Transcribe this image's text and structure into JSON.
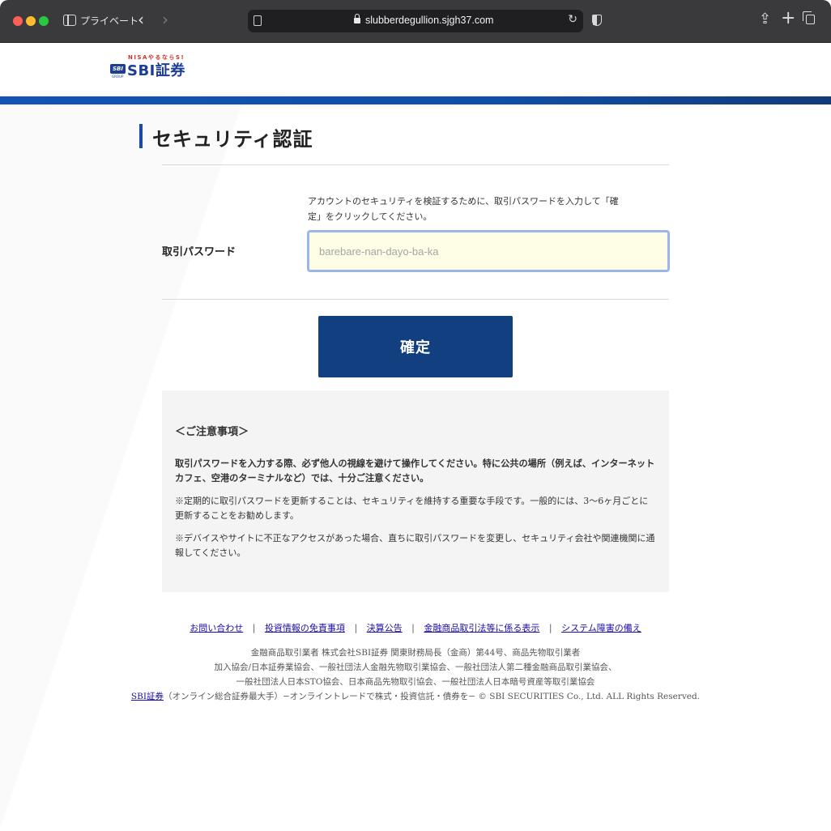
{
  "browser": {
    "private_label": "プライベート",
    "url": "slubberdegullion.sjgh37.com"
  },
  "logo": {
    "nisa_text": "NISAやるならS!",
    "badge_text": "SBI",
    "group_text": "GROUP",
    "main_text": "SBI証券"
  },
  "page": {
    "title": "セキュリティ認証",
    "instructions": "アカウントのセキュリティを検証するために、取引パスワードを入力して「確定」をクリックしてください。",
    "password_label": "取引パスワード",
    "password_value": "barebare-nan-dayo-ba-ka",
    "confirm_label": "確定"
  },
  "notice": {
    "heading": "＜ご注意事項＞",
    "paragraphs": [
      "取引パスワードを入力する際、必ず他人の視線を避けて操作してください。特に公共の場所（例えば、インターネットカフェ、空港のターミナルなど）では、十分ご注意ください。",
      "※定期的に取引パスワードを更新することは、セキュリティを維持する重要な手段です。一般的には、3〜6ヶ月ごとに更新することをお勧めします。",
      "※デバイスやサイトに不正なアクセスがあった場合、直ちに取引パスワードを変更し、セキュリティ会社や関連機関に通報してください。"
    ]
  },
  "footer": {
    "links": [
      "お問い合わせ",
      "投資情報の免責事項",
      "決算公告",
      "金融商品取引法等に係る表示",
      "システム障害の備え"
    ],
    "separator": "|",
    "lines": [
      "金融商品取引業者 株式会社SBI証券 関東財務局長（金商）第44号、商品先物取引業者",
      "加入協会/日本証券業協会、一般社団法人金融先物取引業協会、一般社団法人第二種金融商品取引業協会、",
      "一般社団法人日本STO協会、日本商品先物取引協会、一般社団法人日本暗号資産等取引業協会"
    ],
    "copyright_link": "SBI証券",
    "copyright_text": "（オンライン総合証券最大手）−オンライントレードで株式・投資信託・債券を− © SBI SECURITIES Co., Ltd. ALL Rights Reserved."
  },
  "colors": {
    "header_bar": "#0f4fa8",
    "button_bg": "#123f80",
    "title_accent": "#1c4aa3",
    "input_bg": "#fefde6",
    "input_border": "#9db6ea",
    "notice_bg": "#f4f4f4"
  }
}
